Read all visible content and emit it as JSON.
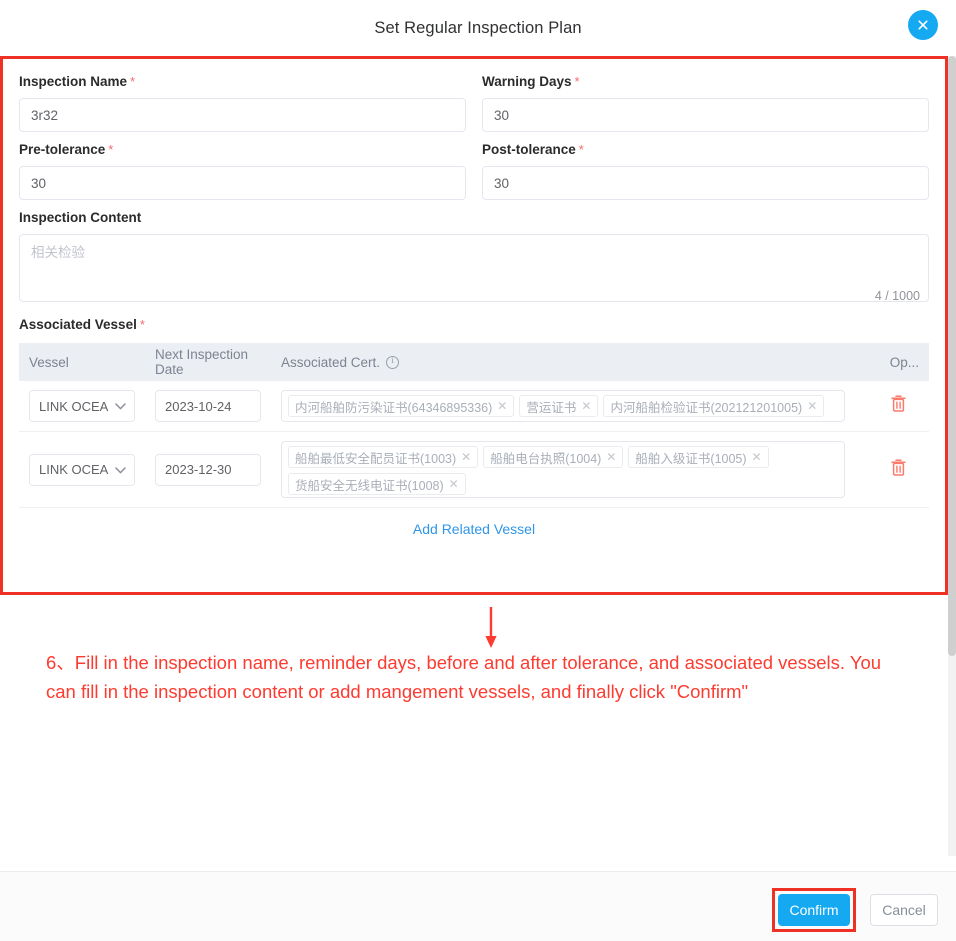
{
  "dialog": {
    "title": "Set Regular Inspection Plan",
    "close_icon": "close-x-icon"
  },
  "form": {
    "inspection_name": {
      "label": "Inspection Name",
      "required_marker": "*",
      "value": "3r32",
      "placeholder": ""
    },
    "warning_days": {
      "label": "Warning Days",
      "required_marker": "*",
      "value": "30",
      "placeholder": ""
    },
    "pre_tolerance": {
      "label": "Pre-tolerance",
      "required_marker": "*",
      "value": "30",
      "placeholder": ""
    },
    "post_tolerance": {
      "label": "Post-tolerance",
      "required_marker": "*",
      "value": "30",
      "placeholder": ""
    },
    "inspection_content": {
      "label": "Inspection Content",
      "value": "",
      "placeholder": "相关检验",
      "counter": "4 / 1000"
    },
    "associated_vessel": {
      "label": "Associated Vessel",
      "required_marker": "*"
    }
  },
  "table": {
    "headers": {
      "vessel": "Vessel",
      "next_inspection_date": "Next Inspection Date",
      "associated_cert": "Associated Cert.",
      "info_icon": "info-circle-icon",
      "operation": "Op..."
    },
    "rows": [
      {
        "vessel": "LINK OCEA",
        "date": "2023-10-24",
        "certs": [
          "内河船舶防污染证书(64346895336)",
          "营运证书",
          "内河船舶检验证书(202121201005)"
        ],
        "delete_icon": "trash-icon"
      },
      {
        "vessel": "LINK OCEA",
        "date": "2023-12-30",
        "certs": [
          "船舶最低安全配员证书(1003)",
          "船舶电台执照(1004)",
          "船舶入级证书(1005)",
          "货船安全无线电证书(1008)"
        ],
        "delete_icon": "trash-icon"
      }
    ],
    "add_link": "Add Related Vessel"
  },
  "annotation": {
    "text": "6、Fill in the inspection name, reminder days, before and after tolerance,  and associated vessels. You can fill in the inspection content or add mangement vessels, and finally click \"Confirm\"",
    "color": "#fd3b30",
    "arrow_icon": "down-arrow-icon"
  },
  "footer": {
    "confirm_label": "Confirm",
    "cancel_label": "Cancel"
  },
  "colors": {
    "accent_blue": "#15a9f2",
    "annotation_red": "#ee3124",
    "required_red": "#f56c6c",
    "trash_red": "#fa7a6c",
    "link_blue": "#2f95e8",
    "header_bg": "#ebeef2"
  }
}
